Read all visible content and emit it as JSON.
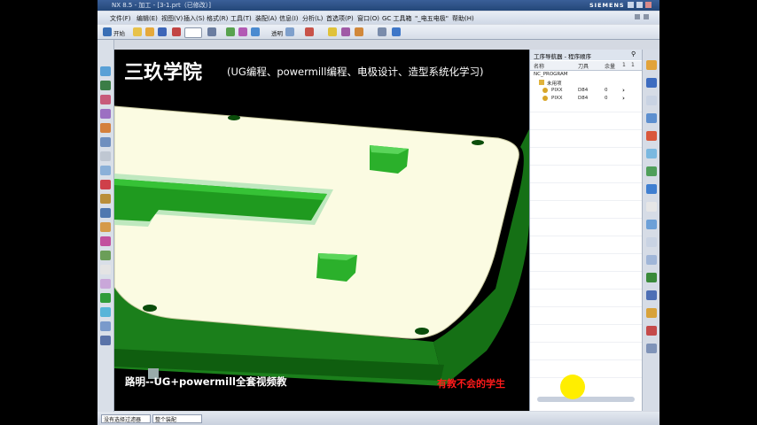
{
  "window": {
    "title": "NX 8.5 - 加工 - [3-1.prt（已修改）]",
    "brand": "SIEMENS"
  },
  "menu": [
    "文件(F)",
    "编辑(E)",
    "视图(V)",
    "插入(S)",
    "格式(R)",
    "工具(T)",
    "装配(A)",
    "信息(I)",
    "分析(L)",
    "首选项(P)",
    "窗口(O)",
    "GC 工具箱",
    "\"_电五电极\"",
    "帮助(H)"
  ],
  "toolbar": {
    "start_label": "开始",
    "display_label": "透明",
    "icons": [
      "start-icon",
      "new-icon",
      "open-icon",
      "save-icon",
      "zoom-field",
      "layer-icon",
      "cut-icon",
      "copy-icon",
      "render-icon",
      "fit-icon",
      "shade-icon",
      "select-icon",
      "wire-icon",
      "orient-icon",
      "snap-icon",
      "measure-icon",
      "view-icon"
    ]
  },
  "viewport": {
    "watermark_title": "三玖学院",
    "watermark_subtitle": "(UG编程、powermill编程、电极设计、造型系统化学习)",
    "subtitle_left": "路明--UG+powermill全套视频教",
    "subtitle_right": "有教不会的学生",
    "colors": {
      "plate": "#fbfbe2",
      "body": "#1d8c1d",
      "highlight": "#2ec82e"
    }
  },
  "navigator": {
    "title": "工序导航器 - 程序顺序",
    "columns": [
      "名称",
      "刀具",
      "余量",
      "1",
      "1"
    ],
    "rows": [
      {
        "name": "NC_PROGRAM",
        "tool": "",
        "stock": ""
      },
      {
        "name": "未用项",
        "tool": "",
        "stock": ""
      },
      {
        "name": "PIXX",
        "tool": "D84",
        "stock": "0"
      },
      {
        "name": "PIXX",
        "tool": "D84",
        "stock": "0"
      }
    ]
  },
  "statusbar": {
    "filter": "没有选择过滤器",
    "scope": "整个装配"
  }
}
